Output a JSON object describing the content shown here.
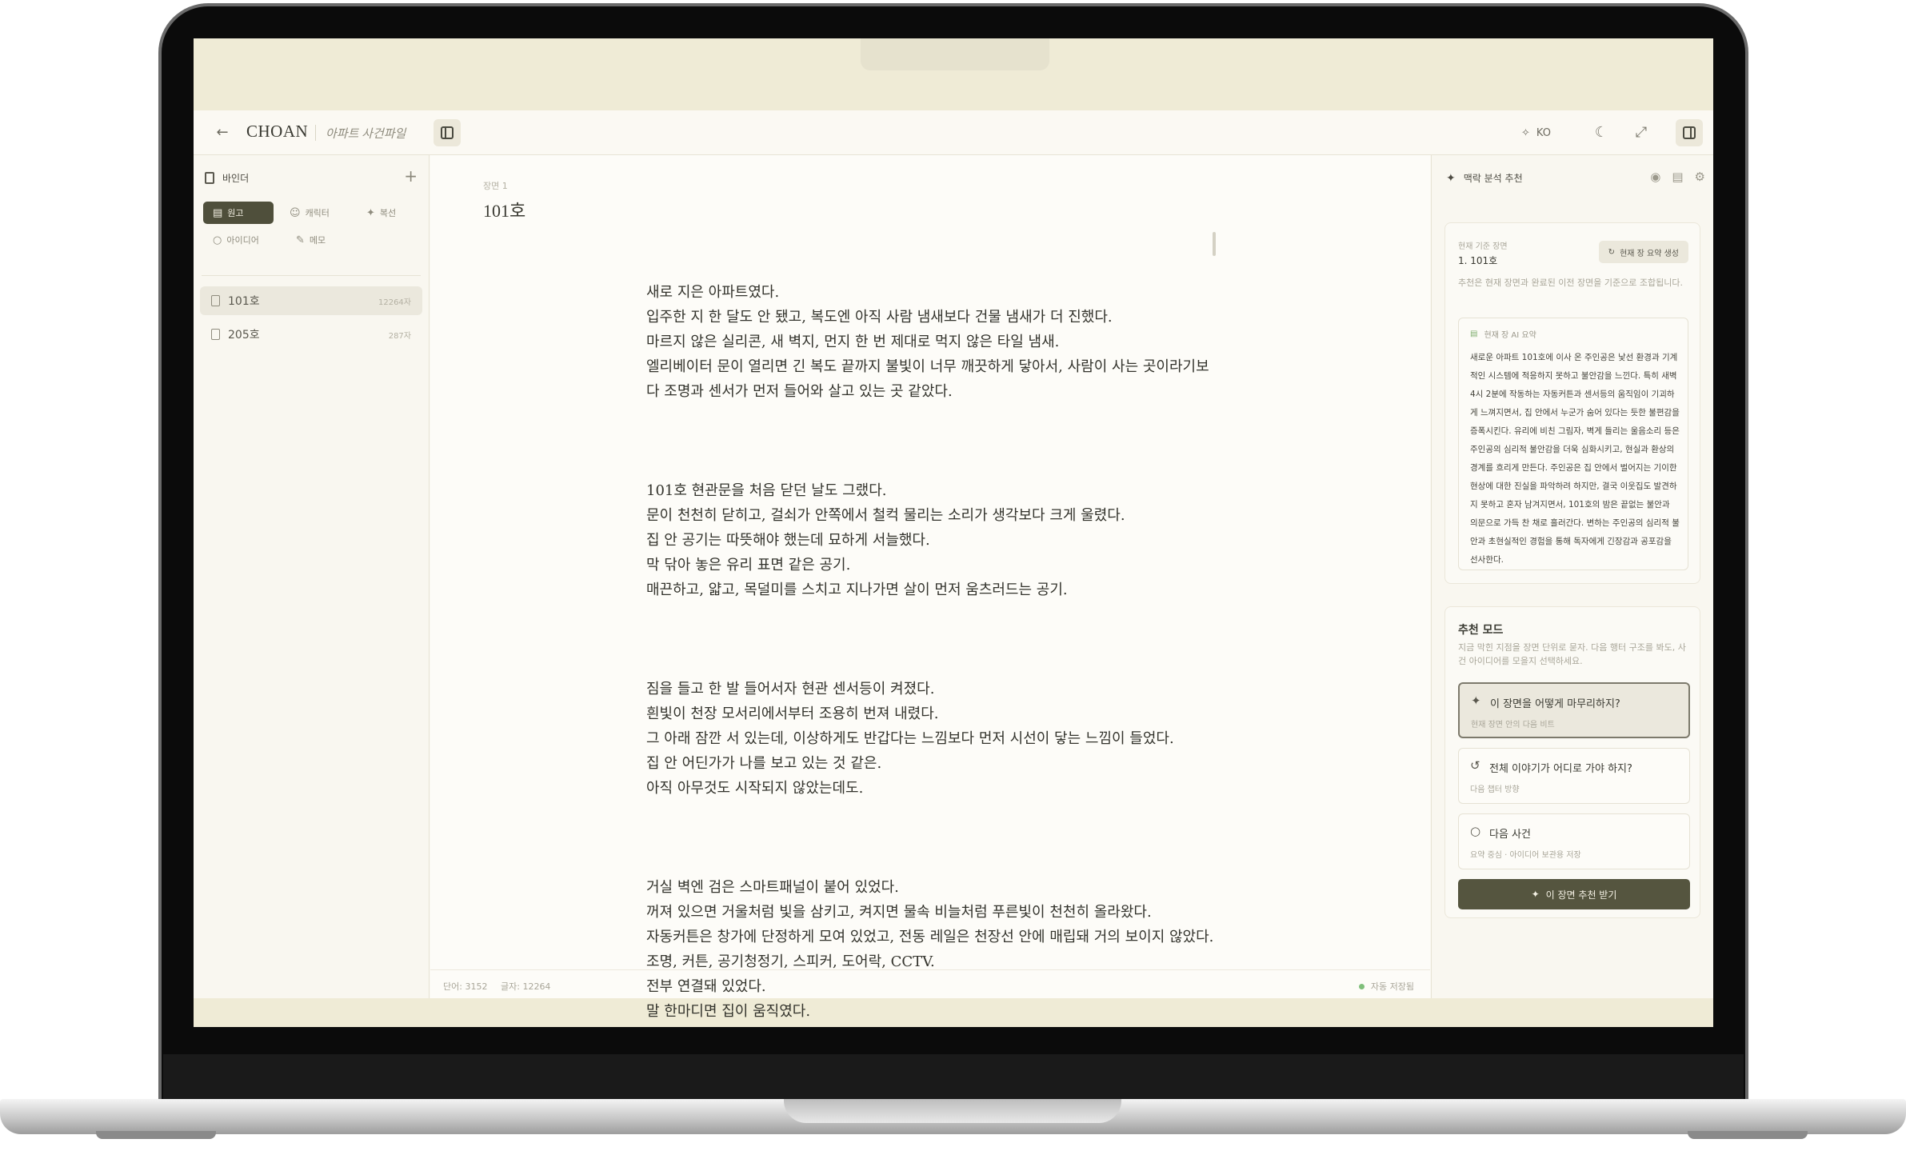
{
  "header": {
    "brand": "CHOAN",
    "project_name": "아파트 사건파일",
    "language": "KO"
  },
  "sidebar": {
    "title": "바인더",
    "tabs": [
      {
        "label": "원고",
        "active": true
      },
      {
        "label": "캐릭터",
        "active": false
      },
      {
        "label": "복선",
        "active": false
      },
      {
        "label": "아이디어",
        "active": false
      },
      {
        "label": "메모",
        "active": false
      }
    ],
    "files": [
      {
        "title": "101호",
        "count": "12264자",
        "active": true
      },
      {
        "title": "205호",
        "count": "287자",
        "active": false
      }
    ]
  },
  "editor": {
    "chapter_label": "장면 1",
    "chapter_title": "101호",
    "paragraphs": [
      "새로 지은 아파트였다.\n입주한 지 한 달도 안 됐고, 복도엔 아직 사람 냄새보다 건물 냄새가 더 진했다.\n마르지 않은 실리콘, 새 벽지, 먼지 한 번 제대로 먹지 않은 타일 냄새.\n엘리베이터 문이 열리면 긴 복도 끝까지 불빛이 너무 깨끗하게 닿아서, 사람이 사는 곳이라기보다 조명과 센서가 먼저 들어와 살고 있는 곳 같았다.",
      "101호 현관문을 처음 닫던 날도 그랬다.\n문이 천천히 닫히고, 걸쇠가 안쪽에서 철컥 물리는 소리가 생각보다 크게 울렸다.\n집 안 공기는 따뜻해야 했는데 묘하게 서늘했다.\n막 닦아 놓은 유리 표면 같은 공기.\n매끈하고, 얇고, 목덜미를 스치고 지나가면 살이 먼저 움츠러드는 공기.",
      "짐을 들고 한 발 들어서자 현관 센서등이 켜졌다.\n흰빛이 천장 모서리에서부터 조용히 번져 내렸다.\n그 아래 잠깐 서 있는데, 이상하게도 반갑다는 느낌보다 먼저 시선이 닿는 느낌이 들었다.\n집 안 어딘가가 나를 보고 있는 것 같은.\n아직 아무것도 시작되지 않았는데도.",
      "거실 벽엔 검은 스마트패널이 붙어 있었다.\n꺼져 있으면 거울처럼 빛을 삼키고, 켜지면 물속 비늘처럼 푸른빛이 천천히 올라왔다.\n자동커튼은 창가에 단정하게 모여 있었고, 전동 레일은 천장선 안에 매립돼 거의 보이지 않았다.\n조명, 커튼, 공기청정기, 스피커, 도어락, CCTV.\n전부 연결돼 있었다.\n말 한마디면 집이 움직였다."
    ],
    "status": {
      "words": "단어: 3152",
      "chars": "글자: 12264",
      "autosave": "자동 저장됨"
    }
  },
  "right_panel": {
    "title": "맥락 분석 추천",
    "current_scene_label": "현재 기준 장면",
    "current_scene_value": "1. 101호",
    "regen_label": "현재 장 요약 생성",
    "help": "추천은 현재 장면과 완료된 이전 장면을 기준으로 조합됩니다.",
    "summary_label": "현재 장 AI 요약",
    "summary": "새로운 아파트 101호에 이사 온 주인공은 낯선 환경과 기계적인 시스템에 적응하지 못하고 불안감을 느낀다. 특히 새벽 4시 2분에 작동하는 자동커튼과 센서등의 움직임이 기괴하게 느껴지면서, 집 안에서 누군가 숨어 있다는 듯한 불편감을 증폭시킨다. 유리에 비친 그림자, 벽게 들리는 울음소리 등은 주인공의 심리적 불안감을 더욱 심화시키고, 현실과 환상의 경계를 흐리게 만든다. 주인공은 집 안에서 벌어지는 기이한 현상에 대한 진실을 파악하려 하지만, 결국 이웃집도 발견하지 못하고 혼자 남겨지면서, 101호의 밤은 끝없는 불안과 의문으로 가득 찬 채로 흘러간다. 변하는 주인공의 심리적 불안과 초현실적인 경험을 통해 독자에게 긴장감과 공포감을 선사한다.",
    "mode_title": "추천 모드",
    "mode_help": "지금 막힌 지점을 장면 단위로 묻자. 다음 행터 구조를 봐도, 사건 아이디어를 모을지 선택하세요.",
    "modes": [
      {
        "label": "이 장면을 어떻게 마무리하지?",
        "sub": "현재 장면 안의 다음 비트",
        "active": true
      },
      {
        "label": "전체 이야기가 어디로 가야 하지?",
        "sub": "다음 챕터 방향",
        "active": false
      },
      {
        "label": "다음 사건",
        "sub": "요약 중심 · 아이디어 보관용 저장",
        "active": false
      }
    ],
    "run_label": "이 장면 추천 받기"
  }
}
